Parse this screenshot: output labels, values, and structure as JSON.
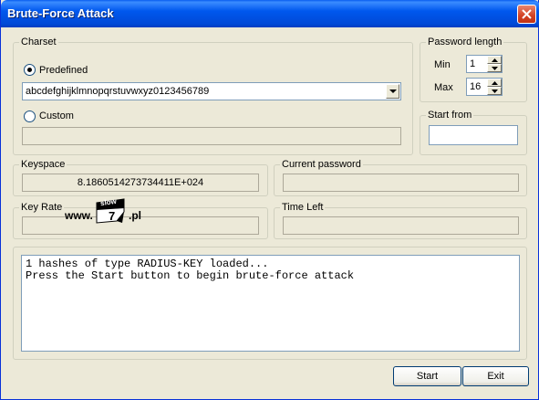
{
  "window": {
    "title": "Brute-Force Attack"
  },
  "charset": {
    "legend": "Charset",
    "predefined_label": "Predefined",
    "predefined_selected": true,
    "predefined_value": "abcdefghijklmnopqrstuvwxyz0123456789",
    "custom_label": "Custom",
    "custom_selected": false,
    "custom_value": ""
  },
  "password_length": {
    "legend": "Password length",
    "min_label": "Min",
    "min_value": "1",
    "max_label": "Max",
    "max_value": "16"
  },
  "start_from": {
    "legend": "Start from",
    "value": ""
  },
  "keyspace": {
    "legend": "Keyspace",
    "value": "8.1860514273734411E+024"
  },
  "current_password": {
    "legend": "Current password",
    "value": ""
  },
  "key_rate": {
    "legend": "Key Rate",
    "value": ""
  },
  "time_left": {
    "legend": "Time Left",
    "value": ""
  },
  "watermark": {
    "text_left": "www.",
    "text_flag": "slow",
    "text_num": "7",
    "text_right": ".pl"
  },
  "log": {
    "line1": "1 hashes of type RADIUS-KEY loaded...",
    "line2": "Press the Start button to begin brute-force attack"
  },
  "buttons": {
    "start": "Start",
    "exit": "Exit"
  }
}
